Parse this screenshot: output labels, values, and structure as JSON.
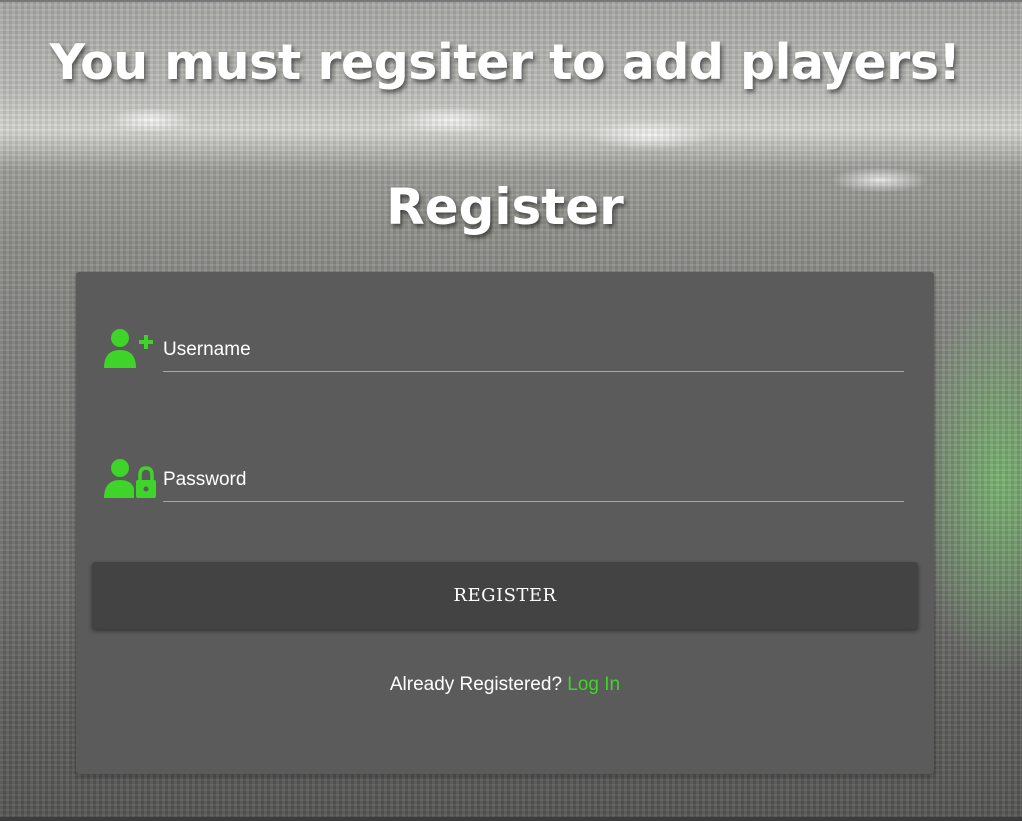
{
  "page": {
    "headline": "You must regsiter to add players!",
    "form_title": "Register"
  },
  "form": {
    "username": {
      "placeholder": "Username",
      "value": "",
      "icon": "user-plus-icon"
    },
    "password": {
      "placeholder": "Password",
      "value": "",
      "icon": "user-lock-icon"
    },
    "submit_label": "REGISTER",
    "login_prompt": "Already Registered?",
    "login_link_label": "Log In"
  },
  "colors": {
    "accent": "#3fd42a",
    "card_bg": "#5b5b5b",
    "button_bg": "#434343",
    "text": "#ffffff"
  }
}
